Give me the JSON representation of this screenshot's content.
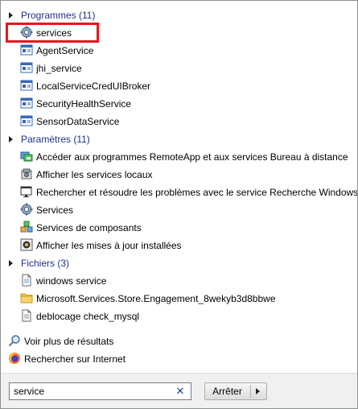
{
  "groups": {
    "programmes": {
      "title": "Programmes (11)",
      "items": [
        {
          "label": "services",
          "icon": "services-gear-icon"
        },
        {
          "label": "AgentService",
          "icon": "app-window-icon"
        },
        {
          "label": "jhi_service",
          "icon": "app-window-icon"
        },
        {
          "label": "LocalServiceCredUIBroker",
          "icon": "app-window-icon"
        },
        {
          "label": "SecurityHealthService",
          "icon": "app-window-icon"
        },
        {
          "label": "SensorDataService",
          "icon": "app-window-icon"
        }
      ]
    },
    "parametres": {
      "title": "Paramètres (11)",
      "items": [
        {
          "label": "Accéder aux programmes RemoteApp et aux services Bureau à distance",
          "icon": "remote-desktop-icon"
        },
        {
          "label": "Afficher les services locaux",
          "icon": "admin-tools-icon"
        },
        {
          "label": "Rechercher et résoudre les problèmes avec le service Recherche Windows",
          "icon": "troubleshoot-icon"
        },
        {
          "label": "Services",
          "icon": "services-gear-icon"
        },
        {
          "label": "Services de composants",
          "icon": "component-services-icon"
        },
        {
          "label": "Afficher les mises à jour installées",
          "icon": "installed-updates-icon"
        }
      ]
    },
    "fichiers": {
      "title": "Fichiers (3)",
      "items": [
        {
          "label": "windows service",
          "icon": "document-icon"
        },
        {
          "label": "Microsoft.Services.Store.Engagement_8wekyb3d8bbwe",
          "icon": "folder-icon"
        },
        {
          "label": "deblocage check_mysql",
          "icon": "document-icon"
        }
      ]
    }
  },
  "links": {
    "see_more": "Voir plus de résultats",
    "search_internet": "Rechercher sur Internet"
  },
  "search": {
    "value": "service",
    "stop_label": "Arrêter"
  },
  "colors": {
    "group_header": "#1e3287",
    "highlight_box": "#e8141c"
  }
}
